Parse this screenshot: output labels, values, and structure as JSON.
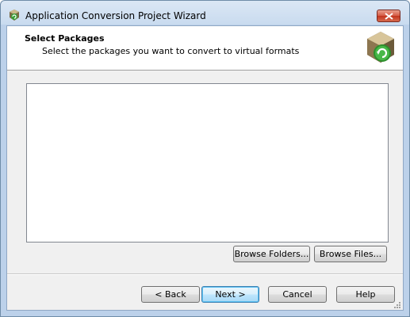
{
  "window": {
    "title": "Application Conversion Project Wizard",
    "icon": "app-wizard-icon"
  },
  "header": {
    "title": "Select Packages",
    "subtitle": "Select the packages you want to convert to virtual formats",
    "icon": "package-convert-icon"
  },
  "packages_list": {
    "items": []
  },
  "browse": {
    "folders_label": "Browse Folders...",
    "files_label": "Browse Files..."
  },
  "footer": {
    "back_label": "< Back",
    "next_label": "Next >",
    "cancel_label": "Cancel",
    "help_label": "Help"
  },
  "colors": {
    "close_button": "#c2341d",
    "default_button_border": "#3c7fb1"
  }
}
